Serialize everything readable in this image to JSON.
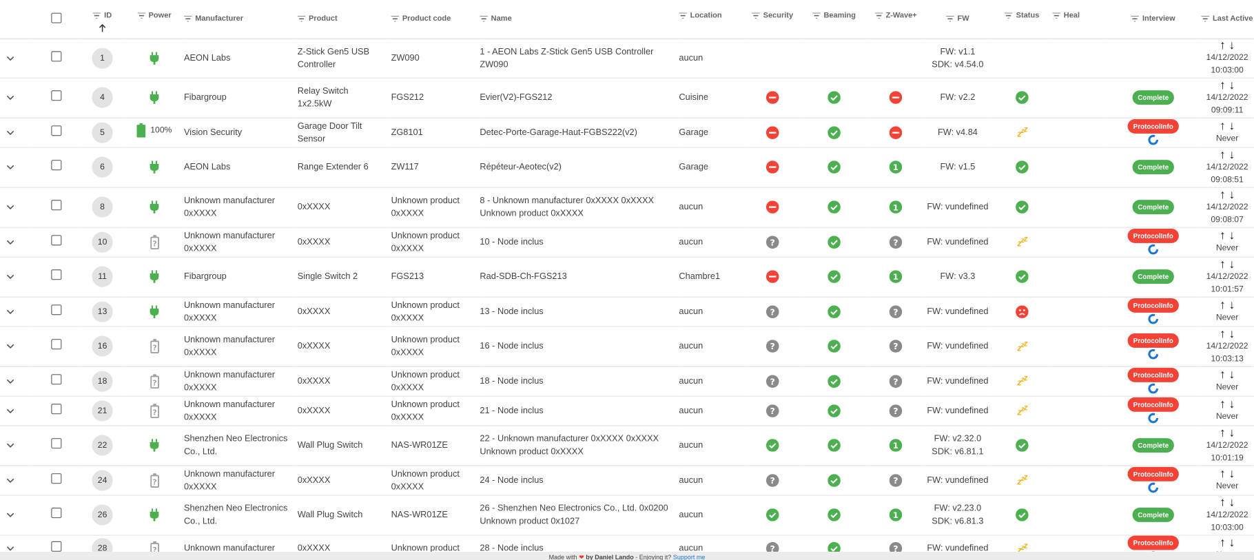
{
  "headers": {
    "id": "ID",
    "power": "Power",
    "manufacturer": "Manufacturer",
    "product": "Product",
    "product_code": "Product code",
    "name": "Name",
    "location": "Location",
    "security": "Security",
    "beaming": "Beaming",
    "zwave_plus": "Z-Wave+",
    "fw": "FW",
    "status": "Status",
    "heal": "Heal",
    "interview": "Interview",
    "last_active": "Last Active"
  },
  "rows": [
    {
      "id": "1",
      "power": "mains",
      "battery": "",
      "manufacturer": [
        "AEON Labs"
      ],
      "product": [
        "Z-Stick Gen5 USB",
        "Controller"
      ],
      "code": [
        "ZW090"
      ],
      "name": [
        "1 - AEON Labs Z-Stick Gen5 USB Controller ZW090"
      ],
      "location": "aucun",
      "security": "",
      "beaming": "",
      "zwave": "",
      "fw": [
        "FW: v1.1",
        "SDK: v4.54.0"
      ],
      "status": "",
      "interview": "",
      "interview_label": "",
      "last_active": [
        "14/12/2022",
        "10:03:00"
      ]
    },
    {
      "id": "4",
      "power": "mains",
      "battery": "",
      "manufacturer": [
        "Fibargroup"
      ],
      "product": [
        "Relay Switch",
        "1x2.5kW"
      ],
      "code": [
        "FGS212"
      ],
      "name": [
        "Evier(V2)-FGS212"
      ],
      "location": "Cuisine",
      "security": "no",
      "beaming": "yes",
      "zwave": "no",
      "fw": [
        "FW: v2.2"
      ],
      "status": "alive",
      "interview": "complete",
      "interview_label": "Complete",
      "last_active": [
        "14/12/2022",
        "09:09:11"
      ]
    },
    {
      "id": "5",
      "power": "battery",
      "battery": "100%",
      "manufacturer": [
        "Vision Security"
      ],
      "product": [
        "Garage Door Tilt",
        "Sensor"
      ],
      "code": [
        "ZG8101"
      ],
      "name": [
        "Detec-Porte-Garage-Haut-FGBS222(v2)"
      ],
      "location": "Garage",
      "security": "no",
      "beaming": "yes",
      "zwave": "no",
      "fw": [
        "FW: v4.84"
      ],
      "status": "asleep",
      "interview": "protocol",
      "interview_label": "ProtocolInfo",
      "last_active": [
        "Never"
      ]
    },
    {
      "id": "6",
      "power": "mains",
      "battery": "",
      "manufacturer": [
        "AEON Labs"
      ],
      "product": [
        "Range Extender 6"
      ],
      "code": [
        "ZW117"
      ],
      "name": [
        "Répéteur-Aeotec(v2)"
      ],
      "location": "Garage",
      "security": "no",
      "beaming": "yes",
      "zwave": "one",
      "fw": [
        "FW: v1.5"
      ],
      "status": "alive",
      "interview": "complete",
      "interview_label": "Complete",
      "last_active": [
        "14/12/2022",
        "09:08:51"
      ]
    },
    {
      "id": "8",
      "power": "mains",
      "battery": "",
      "manufacturer": [
        "Unknown manufacturer",
        "0xXXXX"
      ],
      "product": [
        "0xXXXX"
      ],
      "code": [
        "Unknown product",
        "0xXXXX"
      ],
      "name": [
        "8 - Unknown manufacturer 0xXXXX 0xXXXX",
        "Unknown product 0xXXXX"
      ],
      "location": "aucun",
      "security": "no",
      "beaming": "yes",
      "zwave": "one",
      "fw": [
        "FW: vundefined"
      ],
      "status": "alive",
      "interview": "complete",
      "interview_label": "Complete",
      "last_active": [
        "14/12/2022",
        "09:08:07"
      ]
    },
    {
      "id": "10",
      "power": "unknown",
      "battery": "",
      "manufacturer": [
        "Unknown manufacturer",
        "0xXXXX"
      ],
      "product": [
        "0xXXXX"
      ],
      "code": [
        "Unknown product",
        "0xXXXX"
      ],
      "name": [
        "10 - Node inclus"
      ],
      "location": "aucun",
      "security": "unknown",
      "beaming": "yes",
      "zwave": "unknown",
      "fw": [
        "FW: vundefined"
      ],
      "status": "asleep",
      "interview": "protocol",
      "interview_label": "ProtocolInfo",
      "last_active": [
        "Never"
      ]
    },
    {
      "id": "11",
      "power": "mains",
      "battery": "",
      "manufacturer": [
        "Fibargroup"
      ],
      "product": [
        "Single Switch 2"
      ],
      "code": [
        "FGS213"
      ],
      "name": [
        "Rad-SDB-Ch-FGS213"
      ],
      "location": "Chambre1",
      "security": "no",
      "beaming": "yes",
      "zwave": "one",
      "fw": [
        "FW: v3.3"
      ],
      "status": "alive",
      "interview": "complete",
      "interview_label": "Complete",
      "last_active": [
        "14/12/2022",
        "10:01:57"
      ]
    },
    {
      "id": "13",
      "power": "mains",
      "battery": "",
      "manufacturer": [
        "Unknown manufacturer",
        "0xXXXX"
      ],
      "product": [
        "0xXXXX"
      ],
      "code": [
        "Unknown product",
        "0xXXXX"
      ],
      "name": [
        "13 - Node inclus"
      ],
      "location": "aucun",
      "security": "unknown",
      "beaming": "yes",
      "zwave": "unknown",
      "fw": [
        "FW: vundefined"
      ],
      "status": "dead",
      "interview": "protocol",
      "interview_label": "ProtocolInfo",
      "last_active": [
        "Never"
      ]
    },
    {
      "id": "16",
      "power": "unknown",
      "battery": "",
      "manufacturer": [
        "Unknown manufacturer",
        "0xXXXX"
      ],
      "product": [
        "0xXXXX"
      ],
      "code": [
        "Unknown product",
        "0xXXXX"
      ],
      "name": [
        "16 - Node inclus"
      ],
      "location": "aucun",
      "security": "unknown",
      "beaming": "yes",
      "zwave": "unknown",
      "fw": [
        "FW: vundefined"
      ],
      "status": "asleep",
      "interview": "protocol",
      "interview_label": "ProtocolInfo",
      "last_active": [
        "14/12/2022",
        "10:03:13"
      ]
    },
    {
      "id": "18",
      "power": "unknown",
      "battery": "",
      "manufacturer": [
        "Unknown manufacturer",
        "0xXXXX"
      ],
      "product": [
        "0xXXXX"
      ],
      "code": [
        "Unknown product",
        "0xXXXX"
      ],
      "name": [
        "18 - Node inclus"
      ],
      "location": "aucun",
      "security": "unknown",
      "beaming": "yes",
      "zwave": "unknown",
      "fw": [
        "FW: vundefined"
      ],
      "status": "asleep",
      "interview": "protocol",
      "interview_label": "ProtocolInfo",
      "last_active": [
        "Never"
      ]
    },
    {
      "id": "21",
      "power": "unknown",
      "battery": "",
      "manufacturer": [
        "Unknown manufacturer",
        "0xXXXX"
      ],
      "product": [
        "0xXXXX"
      ],
      "code": [
        "Unknown product",
        "0xXXXX"
      ],
      "name": [
        "21 - Node inclus"
      ],
      "location": "aucun",
      "security": "unknown",
      "beaming": "yes",
      "zwave": "unknown",
      "fw": [
        "FW: vundefined"
      ],
      "status": "asleep",
      "interview": "protocol",
      "interview_label": "ProtocolInfo",
      "last_active": [
        "Never"
      ]
    },
    {
      "id": "22",
      "power": "mains",
      "battery": "",
      "manufacturer": [
        "Shenzhen Neo Electronics",
        "Co., Ltd."
      ],
      "product": [
        "Wall Plug Switch"
      ],
      "code": [
        "NAS-WR01ZE"
      ],
      "name": [
        "22 - Unknown manufacturer 0xXXXX 0xXXXX",
        "Unknown product 0xXXXX"
      ],
      "location": "aucun",
      "security": "yes",
      "beaming": "yes",
      "zwave": "one",
      "fw": [
        "FW: v2.32.0",
        "SDK: v6.81.1"
      ],
      "status": "alive",
      "interview": "complete",
      "interview_label": "Complete",
      "last_active": [
        "14/12/2022",
        "10:01:19"
      ]
    },
    {
      "id": "24",
      "power": "unknown",
      "battery": "",
      "manufacturer": [
        "Unknown manufacturer",
        "0xXXXX"
      ],
      "product": [
        "0xXXXX"
      ],
      "code": [
        "Unknown product",
        "0xXXXX"
      ],
      "name": [
        "24 - Node inclus"
      ],
      "location": "aucun",
      "security": "unknown",
      "beaming": "yes",
      "zwave": "unknown",
      "fw": [
        "FW: vundefined"
      ],
      "status": "asleep",
      "interview": "protocol",
      "interview_label": "ProtocolInfo",
      "last_active": [
        "Never"
      ]
    },
    {
      "id": "26",
      "power": "mains",
      "battery": "",
      "manufacturer": [
        "Shenzhen Neo Electronics",
        "Co., Ltd."
      ],
      "product": [
        "Wall Plug Switch"
      ],
      "code": [
        "NAS-WR01ZE"
      ],
      "name": [
        "26 - Shenzhen Neo Electronics Co., Ltd. 0x0200",
        "Unknown product 0x1027"
      ],
      "location": "aucun",
      "security": "yes",
      "beaming": "yes",
      "zwave": "one",
      "fw": [
        "FW: v2.23.0",
        "SDK: v6.81.3"
      ],
      "status": "alive",
      "interview": "complete",
      "interview_label": "Complete",
      "last_active": [
        "14/12/2022",
        "10:03:00"
      ]
    },
    {
      "id": "28",
      "power": "unknown",
      "battery": "",
      "manufacturer": [
        "Unknown manufacturer"
      ],
      "product": [
        "0xXXXX"
      ],
      "code": [
        "Unknown product"
      ],
      "name": [
        "28 - Node inclus"
      ],
      "location": "aucun",
      "security": "unknown",
      "beaming": "yes",
      "zwave": "unknown",
      "fw": [
        "FW: vundefined"
      ],
      "status": "asleep",
      "interview": "protocol",
      "interview_label": "ProtocolInfo",
      "last_active": [
        "Never"
      ]
    }
  ],
  "footer": {
    "made_with": "Made with",
    "by": "by Daniel Lando",
    "enjoying": "- Enjoying it?",
    "support": "Support me"
  },
  "colors": {
    "green": "#4caf50",
    "red": "#f44336",
    "gray": "#8a8a8a",
    "sleep": "#f1b51c",
    "blue": "#1976d2"
  }
}
